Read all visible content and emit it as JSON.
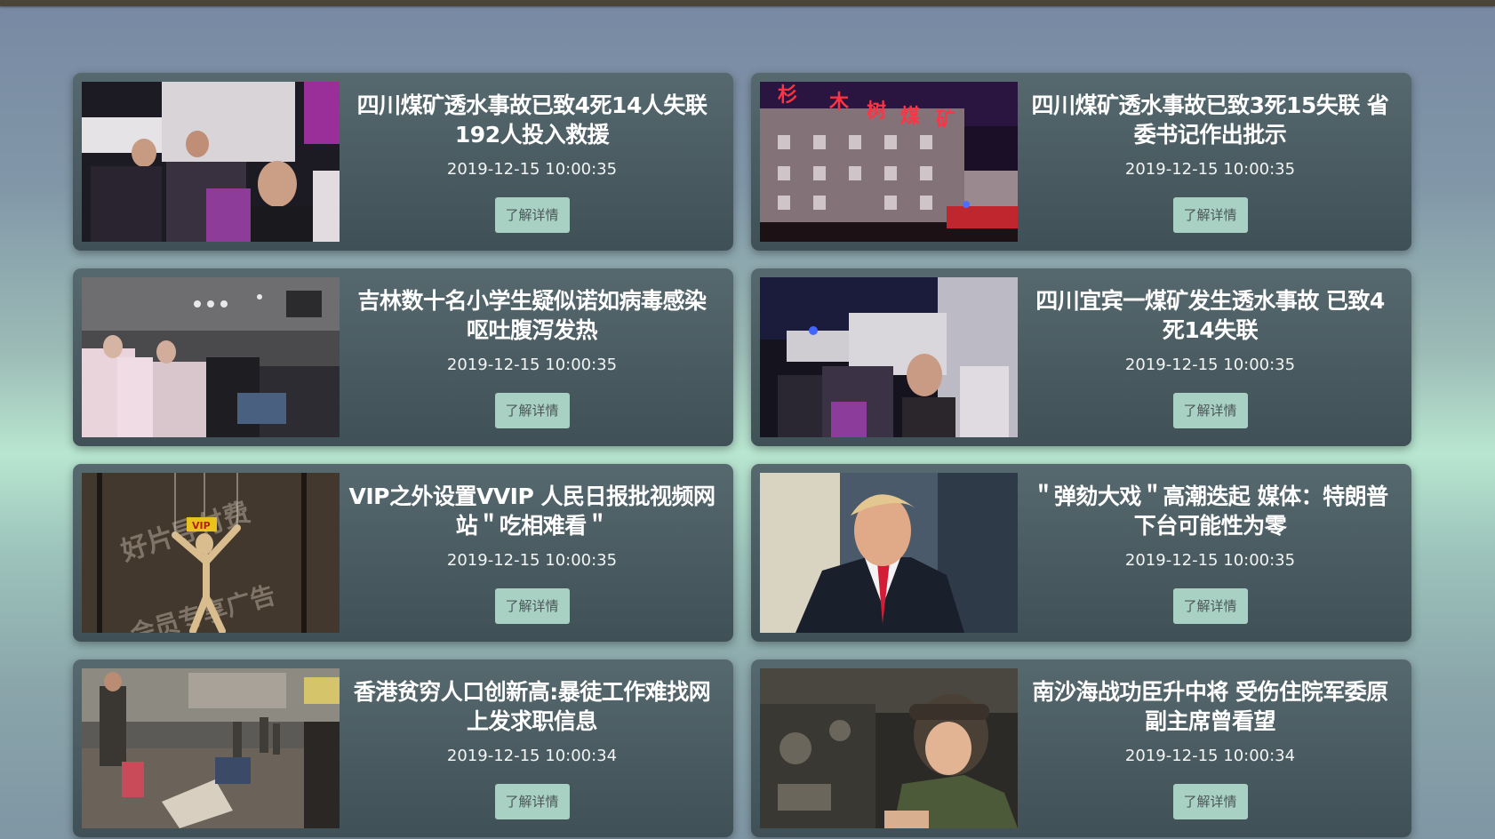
{
  "button_label": "了解详情",
  "news": [
    {
      "title": "四川煤矿透水事故已致4死14人失联 192人投入救援",
      "date": "2019-12-15 10:00:35",
      "image": "rescue-crowd-photo"
    },
    {
      "title": "四川煤矿透水事故已致3死15失联 省委书记作出批示",
      "date": "2019-12-15 10:00:35",
      "image": "coal-mine-building-night-photo",
      "sign_text": "杉木树煤矿"
    },
    {
      "title": "吉林数十名小学生疑似诺如病毒感染 呕吐腹泻发热",
      "date": "2019-12-15 10:00:35",
      "image": "hospital-crowd-photo"
    },
    {
      "title": "四川宜宾一煤矿发生透水事故 已致4死14失联",
      "date": "2019-12-15 10:00:35",
      "image": "rescue-scene-photo"
    },
    {
      "title": "VIP之外设置VVIP 人民日报批视频网站＂吃相难看＂",
      "date": "2019-12-15 10:00:35",
      "image": "puppet-vip-photo",
      "photo_text": [
        "好片导付费",
        "会员专享广告",
        "VIP"
      ]
    },
    {
      "title": "＂弹劾大戏＂高潮迭起 媒体：特朗普下台可能性为零",
      "date": "2019-12-15 10:00:35",
      "image": "politician-portrait-photo"
    },
    {
      "title": "香港贫穷人口创新高:暴徒工作难找网上发求职信息",
      "date": "2019-12-15 10:00:34",
      "image": "street-scene-photo"
    },
    {
      "title": "南沙海战功臣升中将 受伤住院军委原副主席曾看望",
      "date": "2019-12-15 10:00:34",
      "image": "tank-crew-photo"
    }
  ]
}
